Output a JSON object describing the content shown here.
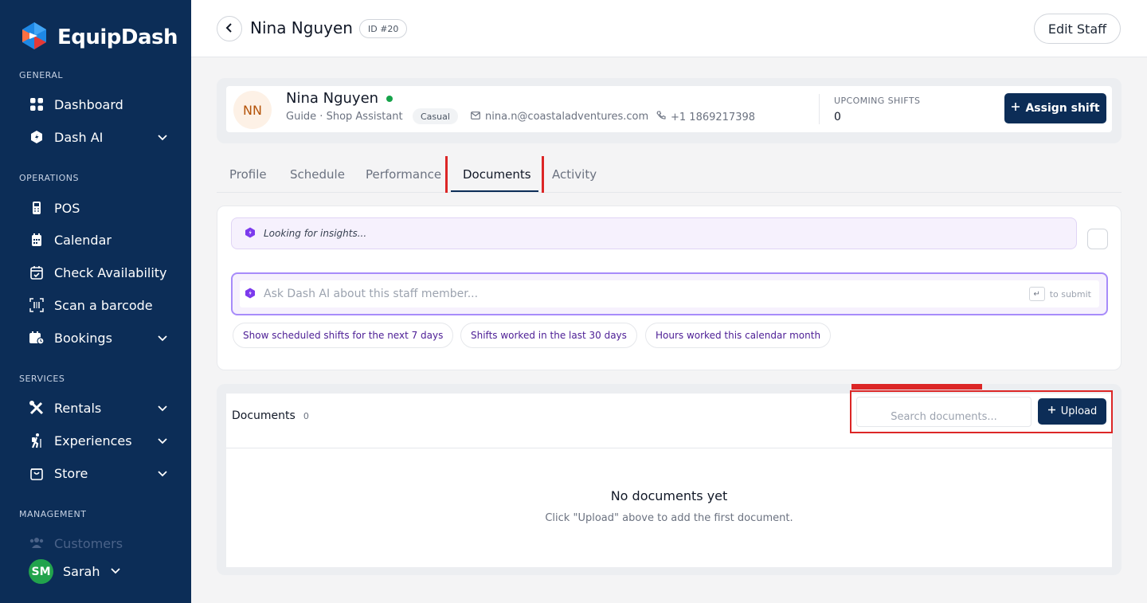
{
  "app": {
    "name": "EquipDash"
  },
  "sidebar": {
    "sections": {
      "general": "GENERAL",
      "operations": "OPERATIONS",
      "services": "SERVICES",
      "management": "MANAGEMENT"
    },
    "items": {
      "dashboard": "Dashboard",
      "dash_ai": "Dash AI",
      "pos": "POS",
      "calendar": "Calendar",
      "check_availability": "Check Availability",
      "scan_barcode": "Scan a barcode",
      "bookings": "Bookings",
      "rentals": "Rentals",
      "experiences": "Experiences",
      "store": "Store",
      "customers": "Customers"
    },
    "user": {
      "initials": "SM",
      "name": "Sarah"
    }
  },
  "header": {
    "title": "Nina Nguyen",
    "id_badge": "ID #20",
    "edit_label": "Edit Staff"
  },
  "profile": {
    "initials": "NN",
    "name": "Nina Nguyen",
    "role": "Guide · Shop Assistant",
    "type": "Casual",
    "email": "nina.n@coastaladventures.com",
    "phone": "+1 1869217398",
    "upcoming_label": "UPCOMING SHIFTS",
    "upcoming_value": "0",
    "assign_label": "Assign shift"
  },
  "tabs": [
    {
      "label": "Profile"
    },
    {
      "label": "Schedule"
    },
    {
      "label": "Performance"
    },
    {
      "label": "Documents",
      "active": true
    },
    {
      "label": "Activity"
    }
  ],
  "ai": {
    "insight_text": "Looking for insights...",
    "ask_placeholder": "Ask Dash AI about this staff member...",
    "submit_hint": "to submit",
    "suggestions": [
      "Show scheduled shifts for the next 7 days",
      "Shifts worked in the last 30 days",
      "Hours worked this calendar month"
    ]
  },
  "documents": {
    "title": "Documents",
    "count": "0",
    "search_placeholder": "Search documents...",
    "upload_label": "Upload",
    "empty_title": "No documents yet",
    "empty_subtitle": "Click \"Upload\" above to add the first document."
  },
  "colors": {
    "navy": "#0c2d57",
    "purple": "#a78bfa",
    "highlight": "#dc2626",
    "online": "#16a34a"
  }
}
